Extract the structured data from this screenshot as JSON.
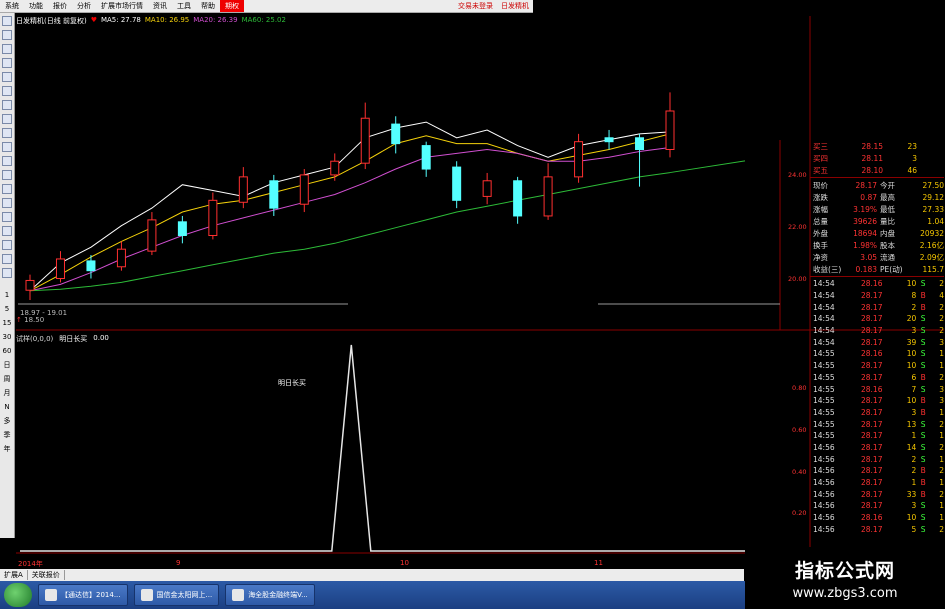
{
  "menu": {
    "items": [
      "系统",
      "功能",
      "报价",
      "分析",
      "扩展市场行情",
      "资讯",
      "工具",
      "帮助"
    ],
    "highlight": "期权",
    "right": [
      "交易未登录",
      "日发精机"
    ]
  },
  "chart_header": {
    "title": "日发精机(日线 前复权)",
    "ma5": "MA5: 27.78",
    "ma10": "MA10: 26.95",
    "ma20": "MA20: 26.39",
    "ma60": "MA60: 25.02",
    "range_label": "18.97 - 19.01",
    "low_label": "18.50"
  },
  "sub_chart": {
    "header": "试样(0,0,0)",
    "indicator": "明日长买",
    "value": "0.00",
    "peak_label": "明日长买"
  },
  "x_axis": [
    "2014年",
    "9",
    "10",
    "11"
  ],
  "price_axis": [
    "24.00",
    "22.00",
    "20.00"
  ],
  "sub_axis": [
    "0.80",
    "0.60",
    "0.40",
    "0.20"
  ],
  "left_toolbar_labels": [
    "1",
    "5",
    "15",
    "30",
    "60",
    "日",
    "周",
    "月",
    "N",
    "多",
    "季",
    "年"
  ],
  "order_book": [
    {
      "label": "买三",
      "price": "28.15",
      "vol": "23"
    },
    {
      "label": "买四",
      "price": "28.11",
      "vol": "3"
    },
    {
      "label": "买五",
      "price": "28.10",
      "vol": "46"
    }
  ],
  "quote": [
    {
      "l1": "现价",
      "v1": "28.17",
      "l2": "今开",
      "v2": "27.50"
    },
    {
      "l1": "涨跌",
      "v1": "0.87",
      "l2": "最高",
      "v2": "29.12"
    },
    {
      "l1": "涨幅",
      "v1": "3.19%",
      "l2": "最低",
      "v2": "27.33"
    },
    {
      "l1": "总量",
      "v1": "39626",
      "l2": "量比",
      "v2": "1.04"
    },
    {
      "l1": "外盘",
      "v1": "18694",
      "l2": "内盘",
      "v2": "20932"
    },
    {
      "l1": "换手",
      "v1": "1.98%",
      "l2": "股本",
      "v2": "2.16亿"
    },
    {
      "l1": "净资",
      "v1": "3.05",
      "l2": "流通",
      "v2": "2.09亿"
    },
    {
      "l1": "收益(三)",
      "v1": "0.183",
      "l2": "PE(动)",
      "v2": "115.7"
    }
  ],
  "ticks": [
    {
      "t": "14:54",
      "p": "28.16",
      "v": "10",
      "s": "S",
      "n": "2"
    },
    {
      "t": "14:54",
      "p": "28.17",
      "v": "8",
      "s": "B",
      "n": "4"
    },
    {
      "t": "14:54",
      "p": "28.17",
      "v": "2",
      "s": "B",
      "n": "2"
    },
    {
      "t": "14:54",
      "p": "28.17",
      "v": "20",
      "s": "S",
      "n": "2"
    },
    {
      "t": "14:54",
      "p": "28.17",
      "v": "3",
      "s": "S",
      "n": "2"
    },
    {
      "t": "14:54",
      "p": "28.17",
      "v": "39",
      "s": "S",
      "n": "3"
    },
    {
      "t": "14:55",
      "p": "28.16",
      "v": "10",
      "s": "S",
      "n": "1"
    },
    {
      "t": "14:55",
      "p": "28.17",
      "v": "10",
      "s": "S",
      "n": "1"
    },
    {
      "t": "14:55",
      "p": "28.17",
      "v": "6",
      "s": "B",
      "n": "2"
    },
    {
      "t": "14:55",
      "p": "28.16",
      "v": "7",
      "s": "S",
      "n": "3"
    },
    {
      "t": "14:55",
      "p": "28.17",
      "v": "10",
      "s": "B",
      "n": "3"
    },
    {
      "t": "14:55",
      "p": "28.17",
      "v": "3",
      "s": "B",
      "n": "1"
    },
    {
      "t": "14:55",
      "p": "28.17",
      "v": "13",
      "s": "S",
      "n": "2"
    },
    {
      "t": "14:55",
      "p": "28.17",
      "v": "1",
      "s": "S",
      "n": "1"
    },
    {
      "t": "14:56",
      "p": "28.17",
      "v": "14",
      "s": "S",
      "n": "2"
    },
    {
      "t": "14:56",
      "p": "28.17",
      "v": "2",
      "s": "S",
      "n": "1"
    },
    {
      "t": "14:56",
      "p": "28.17",
      "v": "2",
      "s": "B",
      "n": "2"
    },
    {
      "t": "14:56",
      "p": "28.17",
      "v": "1",
      "s": "B",
      "n": "1"
    },
    {
      "t": "14:56",
      "p": "28.17",
      "v": "33",
      "s": "B",
      "n": "2"
    },
    {
      "t": "14:56",
      "p": "28.17",
      "v": "3",
      "s": "S",
      "n": "1"
    },
    {
      "t": "14:56",
      "p": "28.16",
      "v": "10",
      "s": "S",
      "n": "1"
    },
    {
      "t": "14:56",
      "p": "28.17",
      "v": "5",
      "s": "S",
      "n": "2"
    }
  ],
  "bottom_tabs": [
    "扩展A",
    "关联报价"
  ],
  "taskbar": {
    "tasks": [
      "【通达信】2014...",
      "国信金太阳网上...",
      "海全股金融终端V..."
    ]
  },
  "watermark": {
    "title": "指标公式网",
    "url": "www.zbgs3.com"
  },
  "colors": {
    "up": "#ff3030",
    "down": "#54ffff",
    "ma5": "#ffffff",
    "ma10": "#f5d20b",
    "ma20": "#d04fd0",
    "ma60": "#2dbb38",
    "grid": "#8a0000",
    "buy": "#ffffff",
    "sell": "#3cff3c"
  },
  "chart_data": [
    {
      "type": "line",
      "series": [
        {
          "name": "MA5",
          "values": [
            18.97,
            20.4,
            21.2,
            22.3,
            23.2,
            24.4,
            24.1,
            23.8,
            24.5,
            24.9,
            25.3,
            26.8,
            27.3,
            27.6,
            26.8,
            27.2,
            26.4,
            25.8,
            26.4,
            26.7,
            27.0,
            27.1
          ]
        },
        {
          "name": "MA10",
          "values": [
            18.97,
            19.8,
            20.7,
            21.5,
            22.2,
            23.0,
            23.4,
            23.6,
            24.0,
            24.4,
            24.8,
            25.6,
            26.5,
            26.9,
            26.5,
            26.5,
            26.0,
            25.6,
            25.9,
            26.2,
            26.6,
            27.0
          ]
        },
        {
          "name": "MA20",
          "values": [
            18.97,
            19.3,
            19.9,
            20.6,
            21.2,
            21.8,
            22.3,
            22.7,
            23.1,
            23.5,
            23.9,
            24.5,
            25.2,
            25.8,
            26.0,
            26.2,
            26.0,
            25.6,
            25.6,
            25.8,
            26.1,
            26.3
          ]
        },
        {
          "name": "MA60",
          "values": [
            18.97,
            19.05,
            19.2,
            19.4,
            19.7,
            20.0,
            20.3,
            20.6,
            20.9,
            21.1,
            21.4,
            21.8,
            22.2,
            22.6,
            23.0,
            23.3,
            23.6,
            23.9,
            24.2,
            24.5,
            24.8,
            25.02
          ]
        }
      ],
      "candles": [
        {
          "o": 19.0,
          "c": 19.5,
          "h": 19.8,
          "l": 18.5
        },
        {
          "o": 19.6,
          "c": 20.6,
          "h": 21.0,
          "l": 19.4
        },
        {
          "o": 20.5,
          "c": 20.0,
          "h": 20.8,
          "l": 19.6
        },
        {
          "o": 20.2,
          "c": 21.1,
          "h": 21.5,
          "l": 20.0
        },
        {
          "o": 21.0,
          "c": 22.6,
          "h": 23.0,
          "l": 20.8
        },
        {
          "o": 22.5,
          "c": 21.8,
          "h": 22.8,
          "l": 21.4
        },
        {
          "o": 21.8,
          "c": 23.6,
          "h": 24.0,
          "l": 21.6
        },
        {
          "o": 23.5,
          "c": 24.8,
          "h": 25.3,
          "l": 23.2
        },
        {
          "o": 24.6,
          "c": 23.2,
          "h": 24.9,
          "l": 22.8
        },
        {
          "o": 23.4,
          "c": 24.9,
          "h": 25.2,
          "l": 23.0
        },
        {
          "o": 24.9,
          "c": 25.6,
          "h": 26.0,
          "l": 24.6
        },
        {
          "o": 25.5,
          "c": 27.8,
          "h": 28.6,
          "l": 25.2
        },
        {
          "o": 27.5,
          "c": 26.5,
          "h": 27.9,
          "l": 26.0
        },
        {
          "o": 26.4,
          "c": 25.2,
          "h": 26.6,
          "l": 24.8
        },
        {
          "o": 25.3,
          "c": 23.6,
          "h": 25.6,
          "l": 23.2
        },
        {
          "o": 23.8,
          "c": 24.6,
          "h": 25.0,
          "l": 23.4
        },
        {
          "o": 24.6,
          "c": 22.8,
          "h": 24.8,
          "l": 22.4
        },
        {
          "o": 22.8,
          "c": 24.8,
          "h": 25.5,
          "l": 22.6
        },
        {
          "o": 24.8,
          "c": 26.6,
          "h": 27.0,
          "l": 24.5
        },
        {
          "o": 26.8,
          "c": 26.6,
          "h": 27.2,
          "l": 26.2
        },
        {
          "o": 26.8,
          "c": 26.2,
          "h": 27.0,
          "l": 24.3
        },
        {
          "o": 26.2,
          "c": 28.17,
          "h": 29.12,
          "l": 25.8
        }
      ],
      "ylim": [
        18.5,
        29.5
      ]
    },
    {
      "type": "line",
      "series": [
        {
          "name": "明日长买",
          "values": [
            0,
            0,
            0,
            0,
            0,
            0,
            0,
            0,
            0,
            0,
            0,
            0,
            0,
            0,
            0,
            0,
            0,
            1,
            0,
            0,
            0,
            0,
            0,
            0,
            0,
            0,
            0,
            0,
            0,
            0,
            0,
            0,
            0,
            0,
            0,
            0,
            0,
            0,
            0,
            0
          ]
        }
      ],
      "ylim": [
        0,
        1
      ]
    }
  ]
}
